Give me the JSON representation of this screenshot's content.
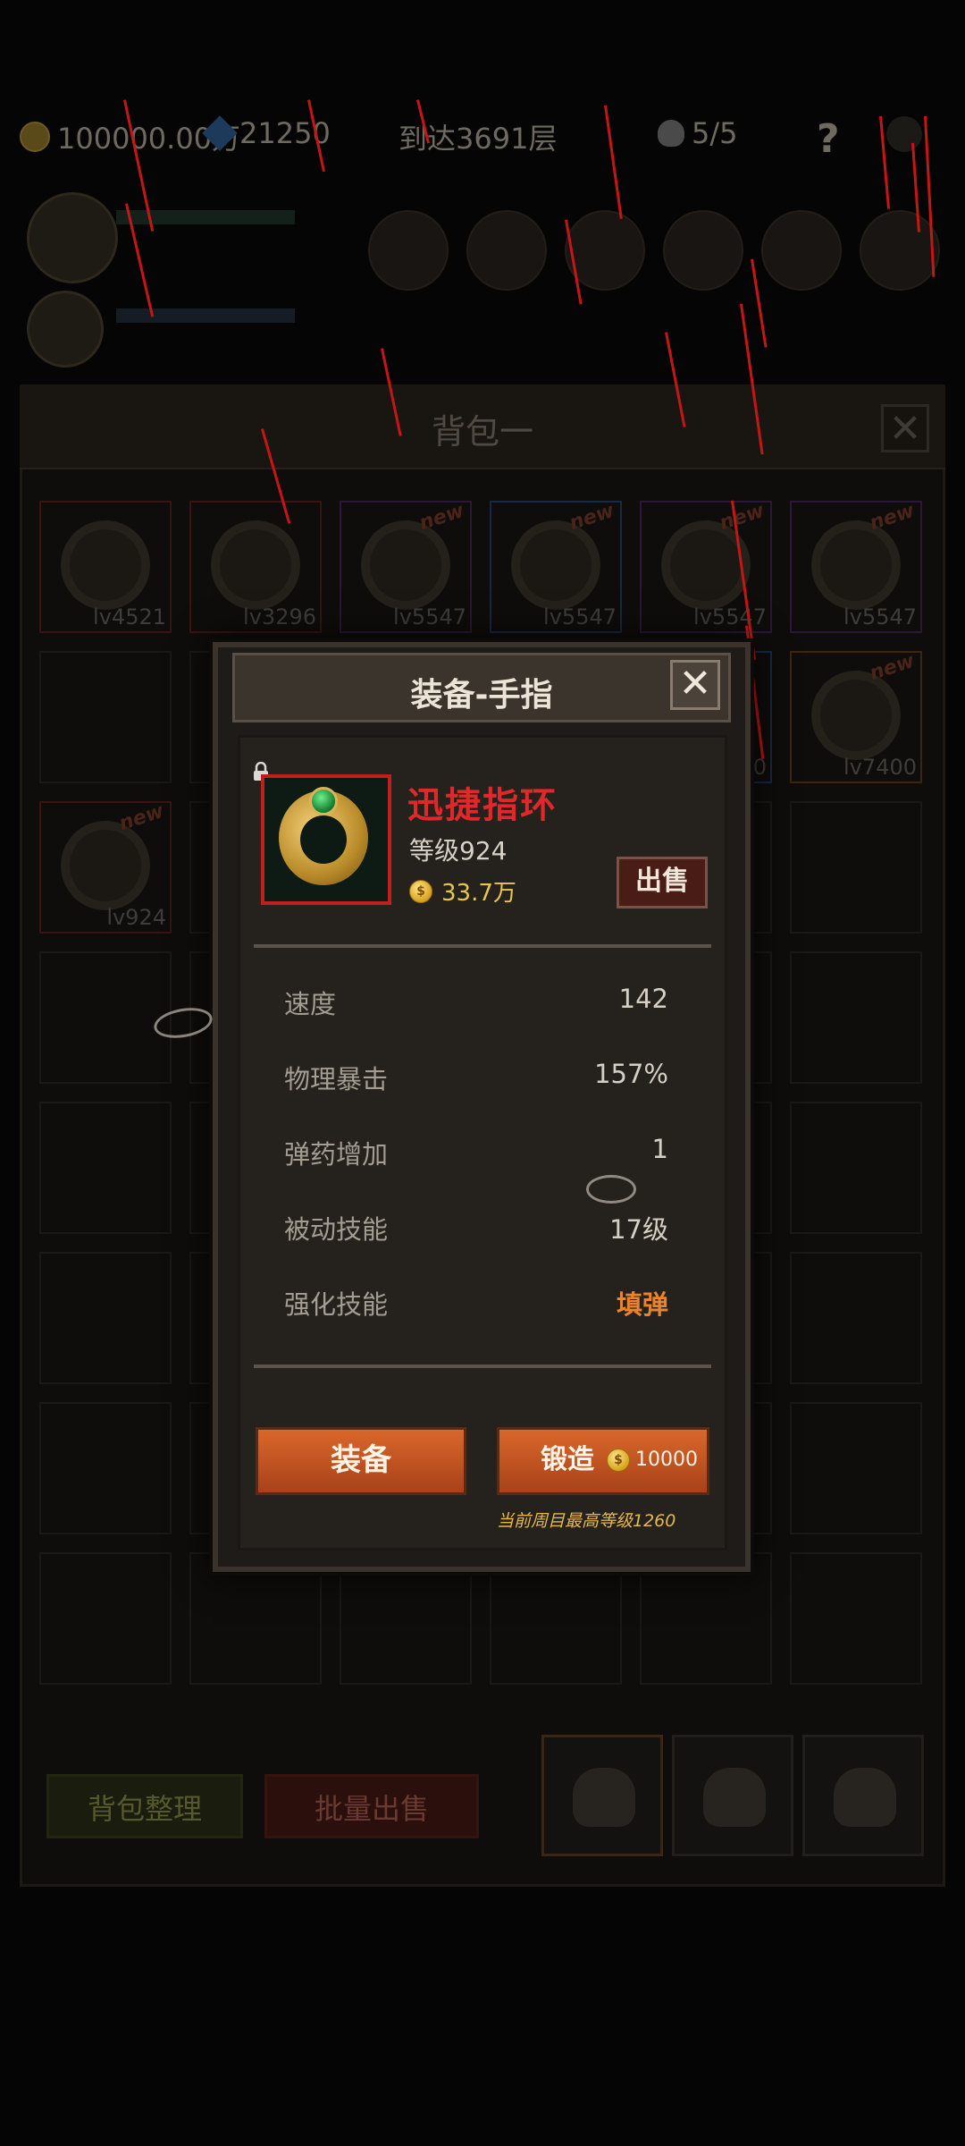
{
  "hud": {
    "gold": "100000.00万",
    "gems": "21250",
    "floor": "到达3691层",
    "lives": "5/5",
    "help": "?"
  },
  "bag": {
    "title": "背包一",
    "close": "✕",
    "items": [
      {
        "level": "lv4521",
        "rarity": "red",
        "new": false
      },
      {
        "level": "lv3296",
        "rarity": "red",
        "new": false
      },
      {
        "level": "lv5547",
        "rarity": "purple",
        "new": true
      },
      {
        "level": "lv5547",
        "rarity": "blue",
        "new": true
      },
      {
        "level": "lv5547",
        "rarity": "purple",
        "new": true
      },
      {
        "level": "lv5547",
        "rarity": "purple",
        "new": true
      },
      {
        "level": "lv5400",
        "rarity": "blue",
        "new": false
      },
      {
        "level": "lv7400",
        "rarity": "orange",
        "new": true
      },
      {
        "level": "lv924",
        "rarity": "red",
        "new": true
      }
    ],
    "sort_button": "背包整理",
    "bulk_sell_button": "批量出售"
  },
  "modal": {
    "title": "装备-手指",
    "close": "✕",
    "item_name": "迅捷指环",
    "item_level": "等级924",
    "price": "33.7万",
    "coin_symbol": "$",
    "sell_button": "出售",
    "stats": [
      {
        "label": "速度",
        "value": "142"
      },
      {
        "label": "物理暴击",
        "value": "157%"
      },
      {
        "label": "弹药增加",
        "value": "1"
      },
      {
        "label": "被动技能",
        "value": "17级"
      },
      {
        "label": "强化技能",
        "value": "填弹"
      }
    ],
    "equip_button": "装备",
    "forge_button": "锻造",
    "forge_cost": "10000",
    "note": "当前周目最高等级1260"
  },
  "colors": {
    "rarity_red": "#c21e1e",
    "accent_orange": "#d9672a",
    "skill_orange": "#e9842c",
    "name_red": "#e0282a",
    "gold_text": "#e8c650"
  }
}
